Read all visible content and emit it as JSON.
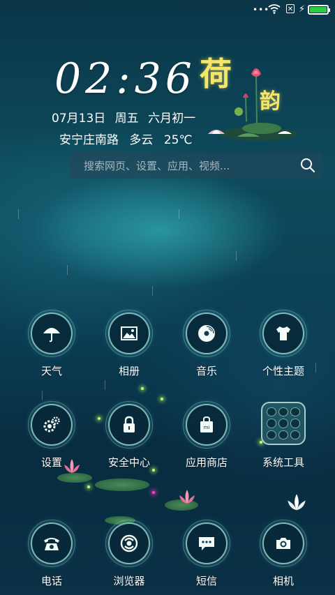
{
  "status_bar": {
    "dots": "•••",
    "sim": "✕",
    "battery_level": 1.0,
    "battery_color": "#2ecc40",
    "icons": [
      "wifi-icon",
      "sim-icon",
      "charging-icon",
      "battery-icon"
    ]
  },
  "widget": {
    "time": "02:36",
    "date": "07月13日",
    "weekday": "周五",
    "lunar": "六月初一",
    "location": "安宁庄南路",
    "weather": "多云",
    "temperature": "25℃",
    "deco_char_1": "荷",
    "deco_char_2": "韵"
  },
  "search": {
    "placeholder": "搜索网页、设置、应用、视频..."
  },
  "apps": {
    "weather": "天气",
    "gallery": "相册",
    "music": "音乐",
    "themes": "个性主题",
    "settings": "设置",
    "security": "安全中心",
    "store": "应用商店",
    "tools": "系统工具",
    "phone": "电话",
    "browser": "浏览器",
    "messages": "短信",
    "camera": "相机"
  },
  "colors": {
    "accent": "#aaebe1",
    "title_gold": "#f5e66a"
  }
}
